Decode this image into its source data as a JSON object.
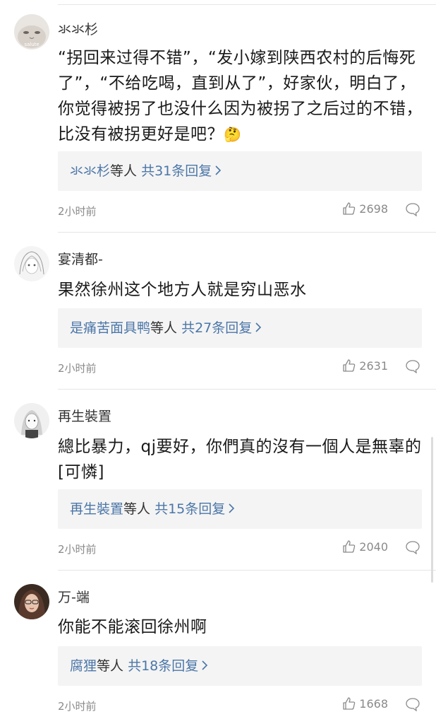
{
  "comments": [
    {
      "username": "氺氺杉",
      "avatar_text": "salute",
      "text": "“拐回来过得不错”，“发小嫁到陕西农村的后悔死了”，“不给吃喝，直到从了”，好家伙，明白了，你觉得被拐了也没什么因为被拐了之后过的不错，比没有被拐更好是吧？",
      "emoji": "🤔",
      "reply_user": "氺氺杉",
      "reply_mid": "等人",
      "reply_count": "共31条回复",
      "time": "2小时前",
      "likes": "2698"
    },
    {
      "username": "宴清都-",
      "text": "果然徐州这个地方人就是穷山恶水",
      "reply_user": "是痛苦面具鸭",
      "reply_mid": "等人",
      "reply_count": "共27条回复",
      "time": "2小时前",
      "likes": "2631"
    },
    {
      "username": "再生裝置",
      "text": "總比暴力，qj要好，你們真的沒有一個人是無辜的[可憐]",
      "reply_user": "再生裝置",
      "reply_mid": "等人",
      "reply_count": "共15条回复",
      "time": "2小时前",
      "likes": "2040"
    },
    {
      "username": "万-端",
      "text": "你能不能滚回徐州啊",
      "reply_user": "腐狸",
      "reply_mid": "等人",
      "reply_count": "共18条回复",
      "time": "2小时前",
      "likes": "1668"
    }
  ],
  "colors": {
    "link_blue": "#4b76a8",
    "reply_bg": "#f4f4f4",
    "meta_gray": "#8a8a8a"
  },
  "icons": {
    "like": "thumbs-up-icon",
    "reply": "comment-bubble-icon",
    "chevron": "chevron-right-icon"
  }
}
